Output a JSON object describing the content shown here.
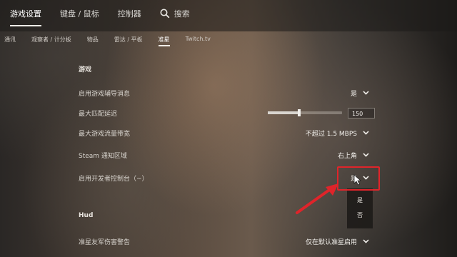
{
  "top_nav": {
    "items": [
      {
        "label": "游戏设置",
        "active": true
      },
      {
        "label": "键盘 / 鼠标",
        "active": false
      },
      {
        "label": "控制器",
        "active": false
      }
    ],
    "search_label": "搜索",
    "search_icon": "search-icon"
  },
  "sub_nav": {
    "items": [
      {
        "label": "通讯",
        "active": false
      },
      {
        "label": "观察者 / 计分板",
        "active": false
      },
      {
        "label": "物品",
        "active": false
      },
      {
        "label": "雷达 / 平板",
        "active": false
      },
      {
        "label": "准星",
        "active": true
      },
      {
        "label": "Twitch.tv",
        "active": false
      }
    ]
  },
  "sections": {
    "game": {
      "title": "游戏",
      "rows": [
        {
          "label": "启用游戏辅导消息",
          "value": "是"
        },
        {
          "label": "最大匹配延迟",
          "value": "150",
          "slider_fraction": 0.42
        },
        {
          "label": "最大游戏流量带宽",
          "value": "不超过 1.5 MBPS"
        },
        {
          "label": "Steam 通知区域",
          "value": "右上角"
        },
        {
          "label": "启用开发者控制台（~）",
          "value": "是"
        }
      ]
    },
    "hud": {
      "title": "Hud",
      "rows": [
        {
          "label": "准星友军伤害警告",
          "value": "仅在默认准星启用"
        }
      ]
    }
  },
  "dropdown": {
    "options": [
      "是",
      "否"
    ]
  },
  "colors": {
    "highlight": "#e0242a",
    "text": "#e8e6e2"
  }
}
